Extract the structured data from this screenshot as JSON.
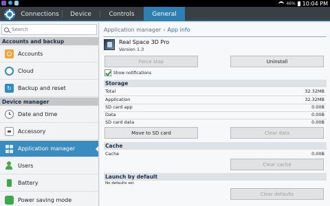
{
  "status_bar": {
    "time": "10:04 PM",
    "battery": "46%"
  },
  "tabs": [
    {
      "label": "Connections"
    },
    {
      "label": "Device"
    },
    {
      "label": "Controls"
    },
    {
      "label": "General"
    }
  ],
  "sidebar": {
    "search_placeholder": "Search",
    "sections": [
      {
        "header": "Accounts and backup"
      },
      {
        "header": "Device manager"
      }
    ],
    "items": [
      {
        "label": "Accounts",
        "icon": "accounts-icon"
      },
      {
        "label": "Cloud",
        "icon": "cloud-icon"
      },
      {
        "label": "Backup and reset",
        "icon": "backup-reset-icon"
      },
      {
        "label": "Date and time",
        "icon": "clock-icon"
      },
      {
        "label": "Accessory",
        "icon": "accessory-icon"
      },
      {
        "label": "Application manager",
        "icon": "apps-grid-icon"
      },
      {
        "label": "Users",
        "icon": "users-icon"
      },
      {
        "label": "Battery",
        "icon": "battery-icon"
      },
      {
        "label": "Power saving mode",
        "icon": "power-saving-icon"
      }
    ],
    "active_item": "Application manager",
    "accent_color": "#3a8bbf"
  },
  "main": {
    "breadcrumb": {
      "parent": "Application manager",
      "separator": "›",
      "current": "App info"
    },
    "app": {
      "name": "Real Space 3D Pro",
      "version": "Version 1.3"
    },
    "buttons": {
      "force_stop": "Force stop",
      "uninstall": "Uninstall",
      "move_to_sd": "Move to SD card",
      "clear_data": "Clear data",
      "clear_cache": "Clear cache",
      "clear_defaults": "Clear defaults"
    },
    "show_notifications": {
      "label": "Show notifications",
      "checked": true
    },
    "storage": {
      "header": "Storage",
      "rows": [
        {
          "label": "Total",
          "value": "32.32MB"
        },
        {
          "label": "Application",
          "value": "32.32MB"
        },
        {
          "label": "SD card app",
          "value": "0.00B"
        },
        {
          "label": "Data",
          "value": "0.00B"
        },
        {
          "label": "SD card data",
          "value": "0.00B"
        }
      ]
    },
    "cache": {
      "header": "Cache",
      "rows": [
        {
          "label": "Cache",
          "value": "0.00B"
        }
      ]
    },
    "launch": {
      "header": "Launch by default",
      "text": "No defaults set"
    }
  }
}
